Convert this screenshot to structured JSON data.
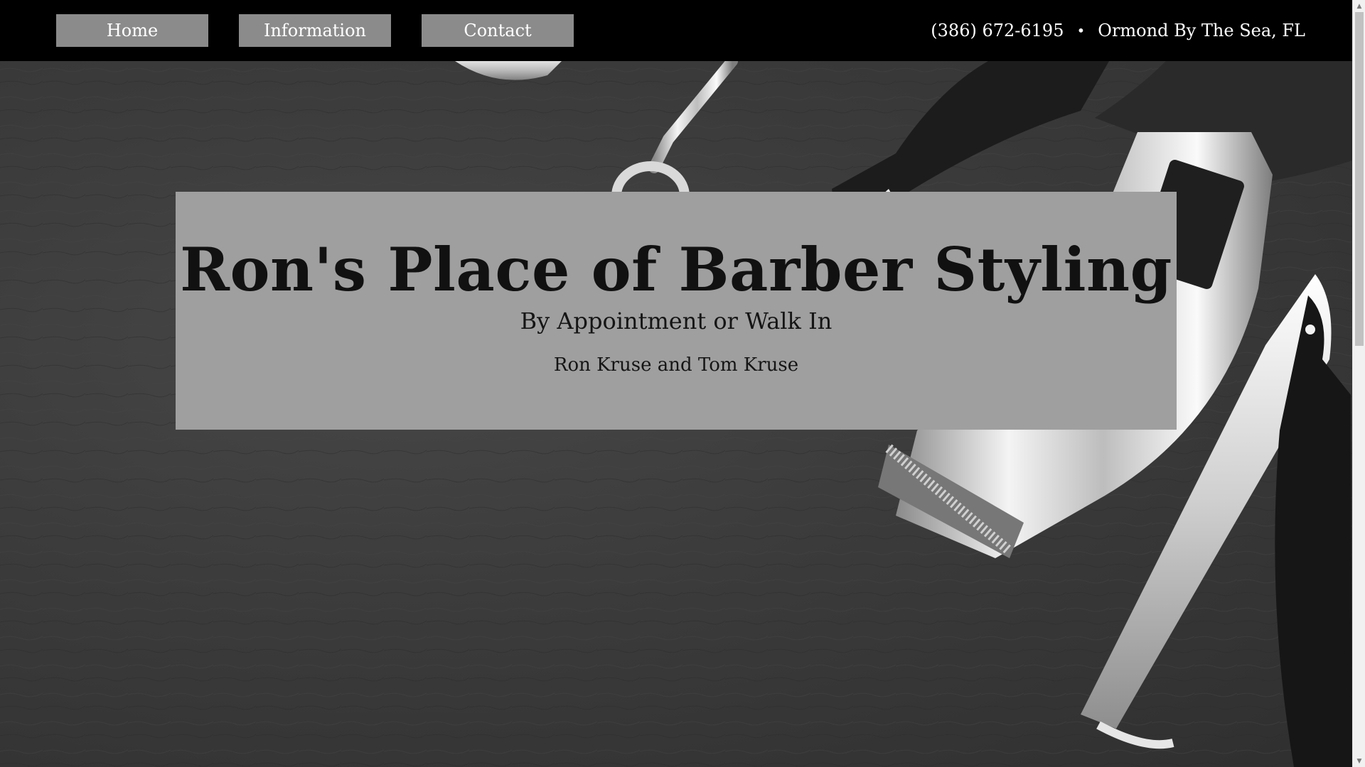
{
  "nav": {
    "home_label": "Home",
    "information_label": "Information",
    "contact_label": "Contact"
  },
  "contact": {
    "phone": "(386) 672-6195",
    "separator": "•",
    "location": "Ormond By The Sea, FL"
  },
  "hero": {
    "title": "Ron's Place of Barber Styling",
    "subtitle": "By Appointment or Walk In",
    "owners": "Ron Kruse and Tom Kruse"
  },
  "scrollbar": {
    "up_glyph": "▲",
    "down_glyph": "▼"
  },
  "colors": {
    "topbar": "#000000",
    "nav_button": "#8b8b8b",
    "title_card": "#9f9f9f",
    "background": "#3a3a3a"
  }
}
